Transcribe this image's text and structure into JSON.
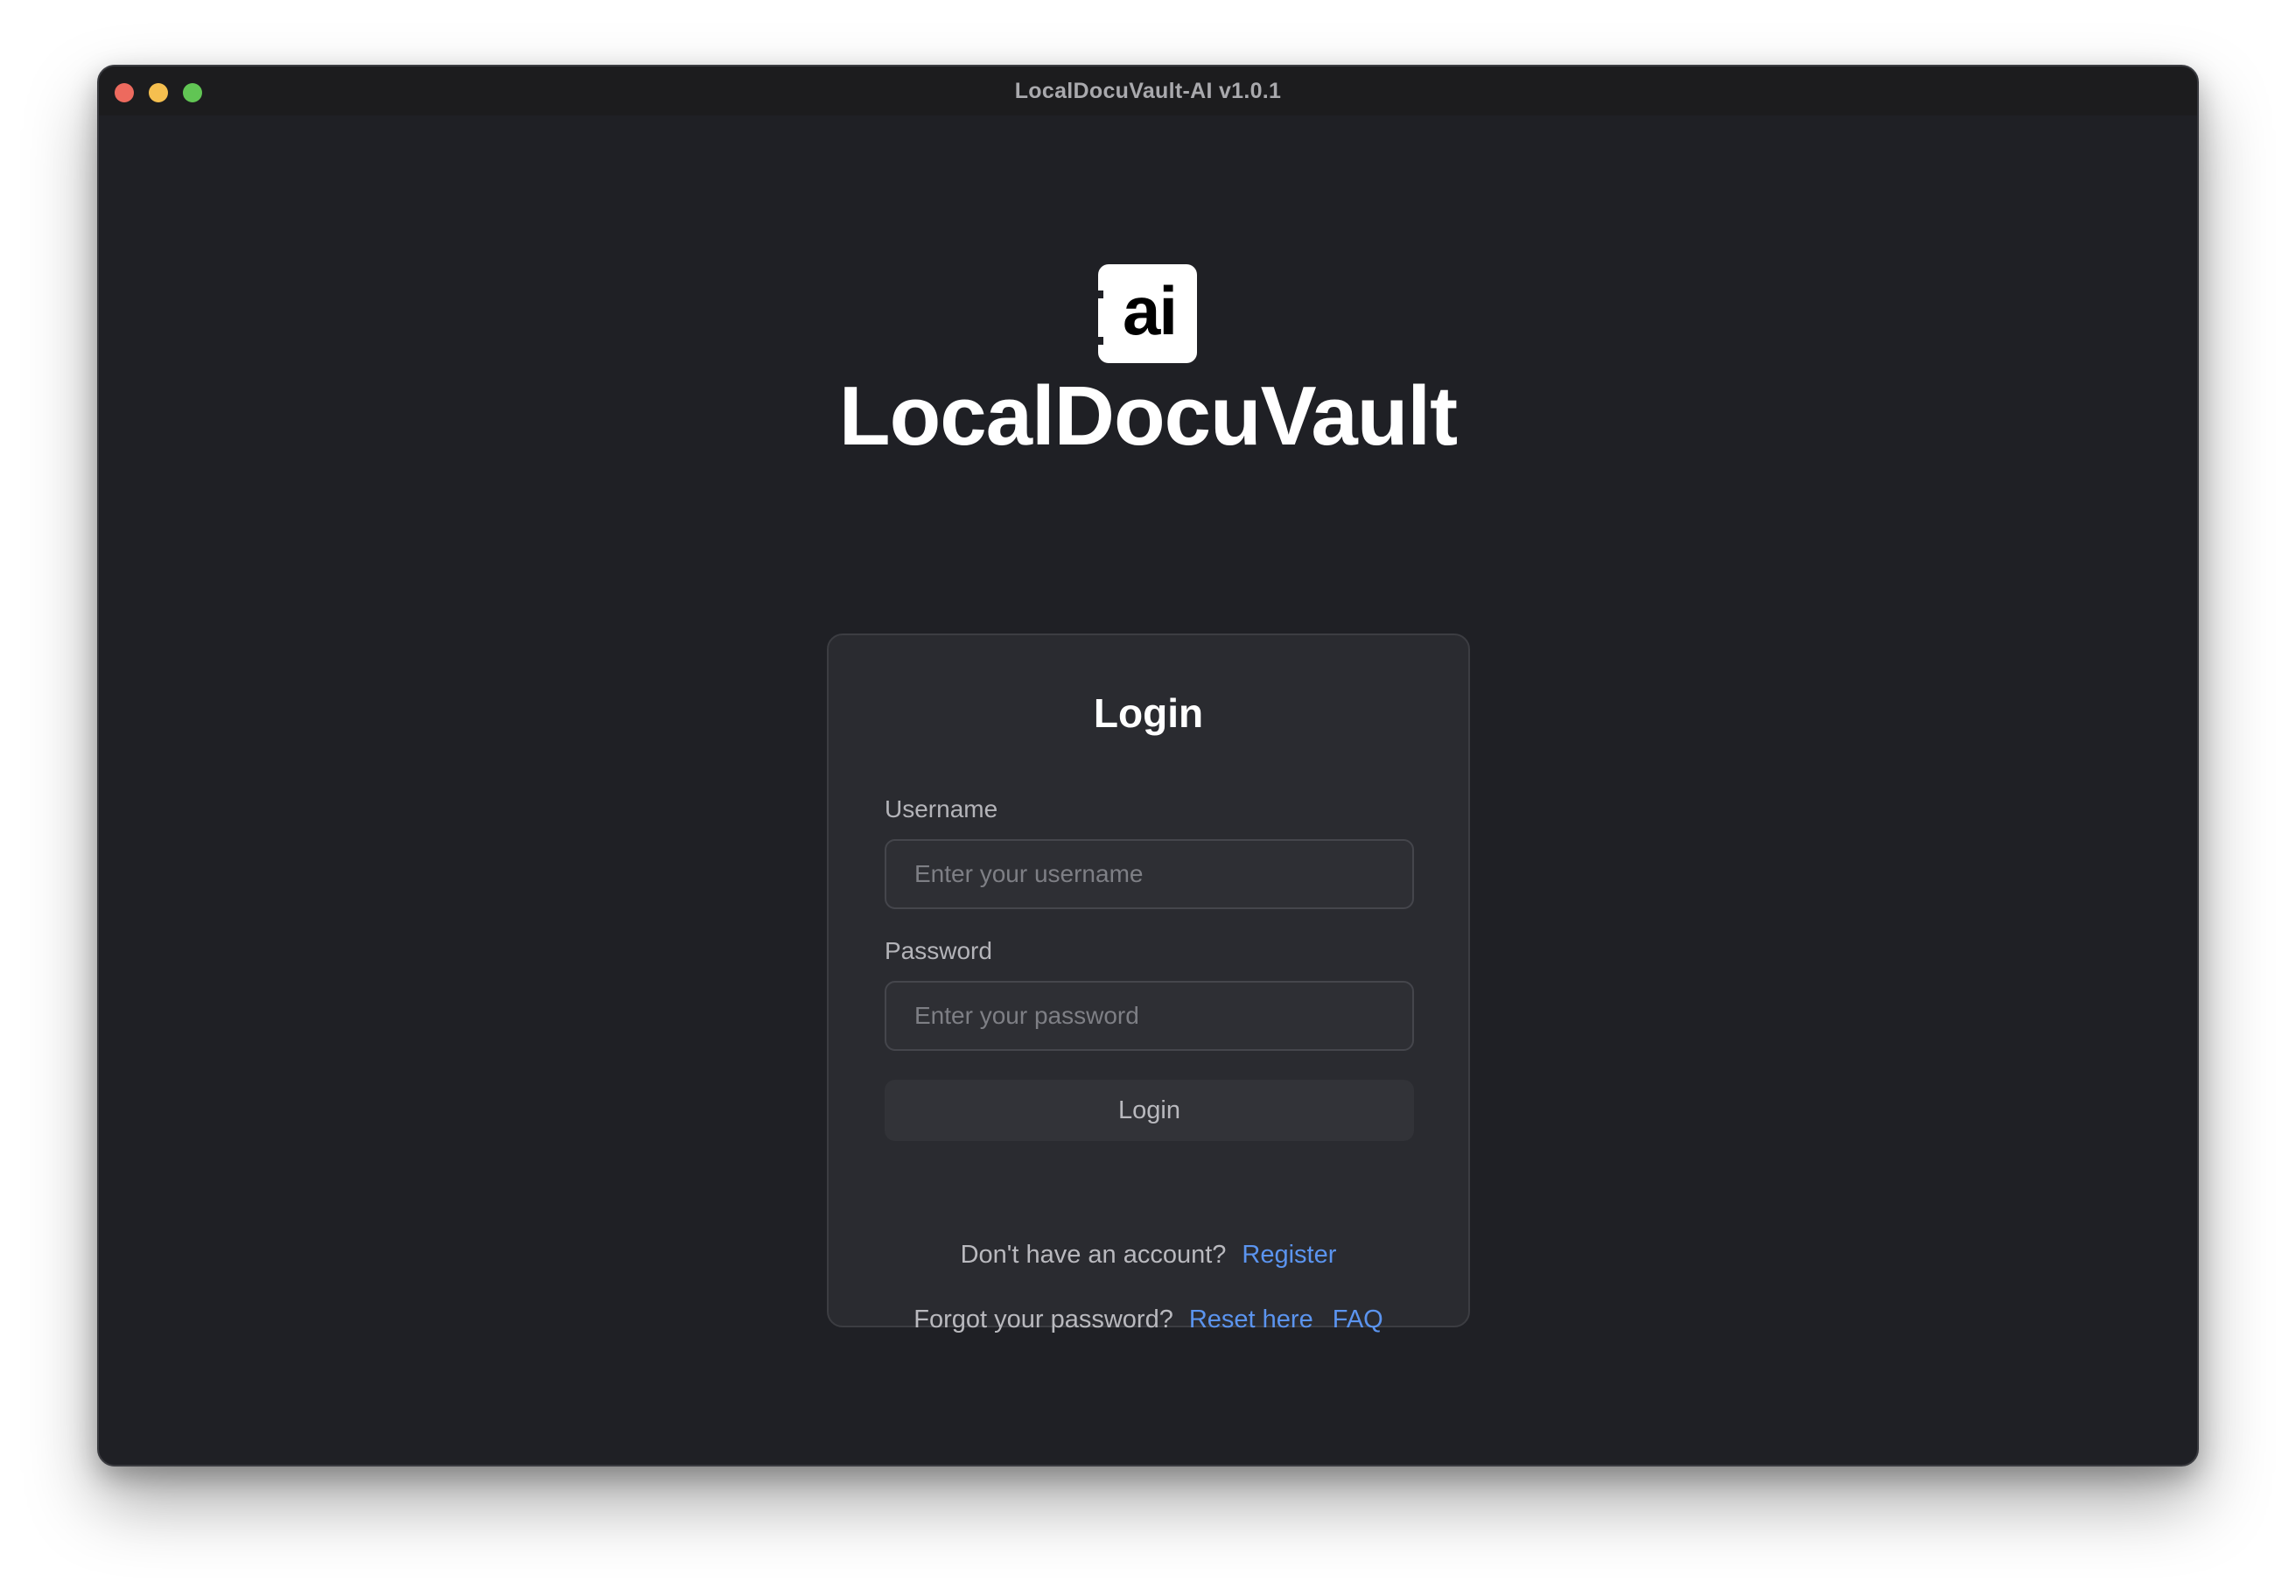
{
  "window": {
    "title": "LocalDocuVault-AI v1.0.1",
    "traffic_colors": {
      "close": "#ed6a5e",
      "minimize": "#f5bf4f",
      "maximize": "#61c554"
    }
  },
  "branding": {
    "logo_text": "ai",
    "app_name": "LocalDocuVault"
  },
  "login_form": {
    "title": "Login",
    "username_label": "Username",
    "username_placeholder": "Enter your username",
    "username_value": "",
    "password_label": "Password",
    "password_placeholder": "Enter your password",
    "password_value": "",
    "submit_label": "Login",
    "register_prompt": "Don't have an account?",
    "register_link": "Register",
    "forgot_prompt": "Forgot your password?",
    "reset_link": "Reset here",
    "faq_link": "FAQ"
  },
  "colors": {
    "background": "#1f2025",
    "card": "#2a2b30",
    "link": "#5b94ef"
  }
}
